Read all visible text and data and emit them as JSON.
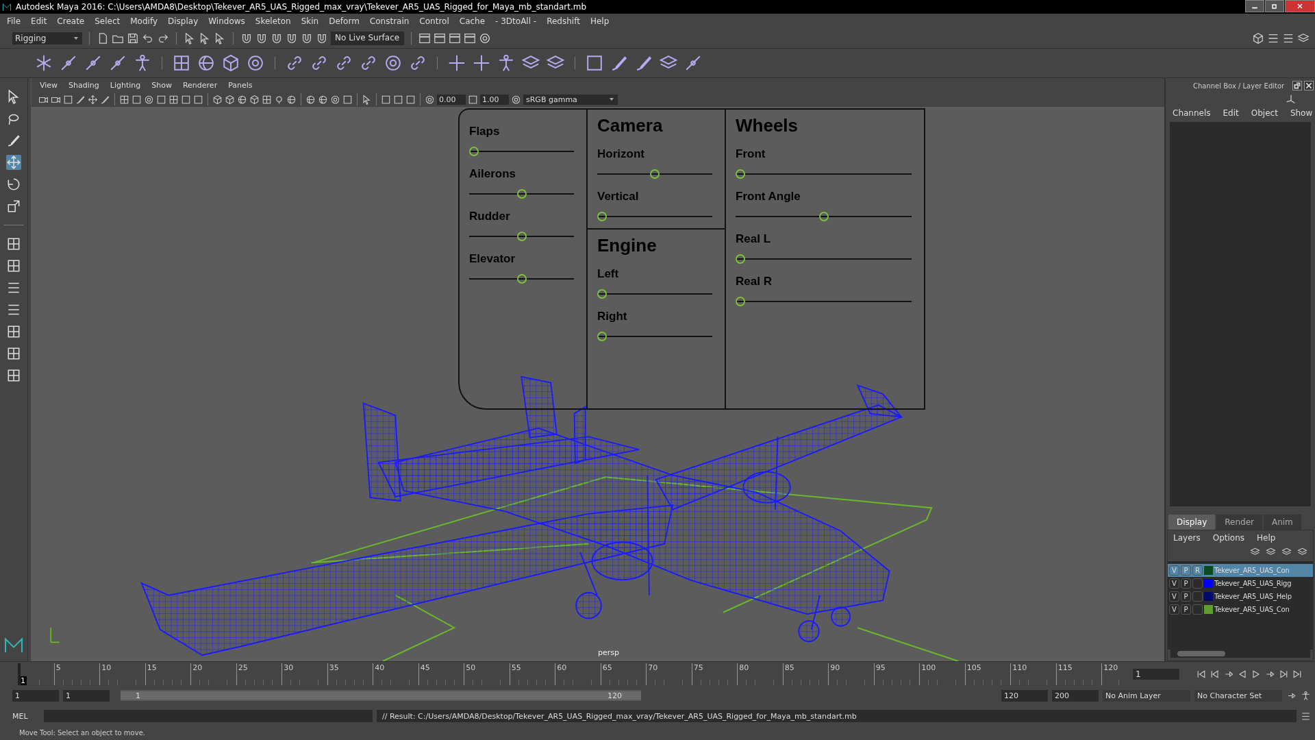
{
  "window": {
    "title": "Autodesk Maya 2016: C:\\Users\\AMDA8\\Desktop\\Tekever_AR5_UAS_Rigged_max_vray\\Tekever_AR5_UAS_Rigged_for_Maya_mb_standart.mb"
  },
  "menu_bar": [
    "File",
    "Edit",
    "Create",
    "Select",
    "Modify",
    "Display",
    "Windows",
    "Skeleton",
    "Skin",
    "Deform",
    "Constrain",
    "Control",
    "Cache",
    "- 3DtoAll -",
    "Redshift",
    "Help"
  ],
  "status_line": {
    "menu_set": "Rigging",
    "live_surface": "No Live Surface"
  },
  "panel_menu": [
    "View",
    "Shading",
    "Lighting",
    "Show",
    "Renderer",
    "Panels"
  ],
  "viewport_toolbar": {
    "exposure": "0.00",
    "gamma": "1.00",
    "color_space": "sRGB gamma"
  },
  "viewport": {
    "camera_label": "persp",
    "rig_panel": [
      {
        "groups": [
          {
            "sliders": [
              {
                "label": "Flaps",
                "level": 0
              },
              {
                "label": "Ailerons",
                "level": 0.5
              },
              {
                "label": "Rudder",
                "level": 0.5
              },
              {
                "label": "Elevator",
                "level": 0.5
              }
            ]
          }
        ]
      },
      {
        "groups": [
          {
            "title": "Camera",
            "sliders": [
              {
                "label": "Horizont",
                "level": 0.5
              },
              {
                "label": "Vertical",
                "level": 0
              }
            ]
          },
          {
            "title": "Engine",
            "sliders": [
              {
                "label": "Left",
                "level": 0
              },
              {
                "label": "Right",
                "level": 0
              }
            ]
          }
        ]
      },
      {
        "groups": [
          {
            "title": "Wheels",
            "sliders": [
              {
                "label": "Front",
                "level": 0
              },
              {
                "label": "Front Angle",
                "level": 0.5
              },
              {
                "label": "Real L",
                "level": 0
              },
              {
                "label": "Real R",
                "level": 0
              }
            ]
          }
        ]
      }
    ]
  },
  "channel_box": {
    "title": "Channel Box / Layer Editor",
    "menus": [
      "Channels",
      "Edit",
      "Object",
      "Show"
    ]
  },
  "layer_editor": {
    "tabs": [
      {
        "label": "Display",
        "selected": true
      },
      {
        "label": "Render",
        "selected": false
      },
      {
        "label": "Anim",
        "selected": false
      }
    ],
    "menus": [
      "Layers",
      "Options",
      "Help"
    ],
    "layers": [
      {
        "v": "V",
        "p": "P",
        "r": "R",
        "name": "Tekever_AR5_UAS_Con",
        "color": "#0b4a1e",
        "selected": true
      },
      {
        "v": "V",
        "p": "P",
        "name": "Tekever_AR5_UAS_Rigg",
        "color": "#0000ff",
        "selected": false
      },
      {
        "v": "V",
        "p": "P",
        "name": "Tekever_AR5_UAS_Help",
        "color": "#000a6b",
        "selected": false
      },
      {
        "v": "V",
        "p": "P",
        "name": "Tekever_AR5_UAS_Con",
        "color": "#5e9e2e",
        "selected": false
      }
    ]
  },
  "timeline": {
    "start_label": "1",
    "ticks": [
      "5",
      "10",
      "15",
      "20",
      "25",
      "30",
      "35",
      "40",
      "45",
      "50",
      "55",
      "60",
      "65",
      "70",
      "75",
      "80",
      "85",
      "90",
      "95",
      "100",
      "105",
      "110",
      "115",
      "120"
    ],
    "current_frame": "1",
    "level": 0
  },
  "range": {
    "start": "1",
    "playback_start": "1",
    "slider_start": "1",
    "slider_end": "120",
    "level": 1,
    "playback_end": "120",
    "end": "200",
    "anim_layer": "No Anim Layer",
    "character_set": "No Character Set"
  },
  "command_line": {
    "language": "MEL",
    "result": "// Result: C:/Users/AMDA8/Desktop/Tekever_AR5_UAS_Rigged_max_vray/Tekever_AR5_UAS_Rigged_for_Maya_mb_standart.mb"
  },
  "help_line": "Move Tool: Select an object to move."
}
